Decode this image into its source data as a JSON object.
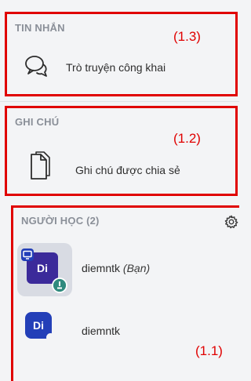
{
  "messages": {
    "title": "TIN NHẮN",
    "annotation": "(1.3)",
    "item_label": "Trò truyện công khai",
    "icon": "chat-bubbles-icon"
  },
  "notes": {
    "title": "GHI CHÚ",
    "annotation": "(1.2)",
    "item_label": "Ghi chú được chia sẻ",
    "icon": "document-icon"
  },
  "users": {
    "title": "NGƯỜI HỌC (2)",
    "annotation": "(1.1)",
    "settings_icon": "gear-icon",
    "list": [
      {
        "initials": "Di",
        "name": "diemntk",
        "suffix": "(Bạn)",
        "is_self": true,
        "presenter_icon": "presenter-monitor-icon",
        "status_icon": "moderator-status-icon"
      },
      {
        "initials": "Di",
        "name": "diemntk",
        "suffix": "",
        "is_self": false
      }
    ]
  },
  "colors": {
    "annotation": "#e00000",
    "avatar": "#233fb8",
    "self_avatar": "#3b2a9a",
    "status_badge": "#2f8a7e",
    "section_title": "#8a8f98",
    "background": "#f3f4f6"
  }
}
